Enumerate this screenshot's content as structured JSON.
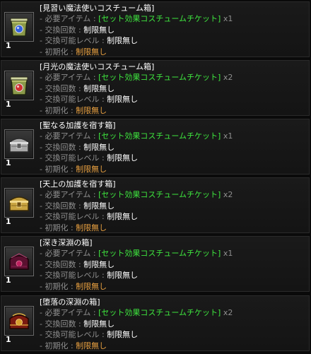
{
  "labels": {
    "required_item": "- 必要アイテム :",
    "exchange_count": "- 交換回数 :",
    "exchange_level": "- 交換可能レベル :",
    "reset": "- 初期化 :"
  },
  "items": [
    {
      "title": "[見習い魔法使いコスチューム箱]",
      "ticket": "[セット効果コスチュームチケット]",
      "ticket_qty": "x1",
      "count": "制限無し",
      "level": "制限無し",
      "reset": "制限無し",
      "quantity": "1",
      "icon": "green-costume-box-icon"
    },
    {
      "title": "[月光の魔法使いコスチューム箱]",
      "ticket": "[セット効果コスチュームチケット]",
      "ticket_qty": "x2",
      "count": "制限無し",
      "level": "制限無し",
      "reset": "制限無し",
      "quantity": "1",
      "icon": "green-costume-box-icon"
    },
    {
      "title": "[聖なる加護を宿す箱]",
      "ticket": "[セット効果コスチュームチケット]",
      "ticket_qty": "x1",
      "count": "制限無し",
      "level": "制限無し",
      "reset": "制限無し",
      "quantity": "1",
      "icon": "silver-chest-icon"
    },
    {
      "title": "[天上の加護を宿す箱]",
      "ticket": "[セット効果コスチュームチケット]",
      "ticket_qty": "x2",
      "count": "制限無し",
      "level": "制限無し",
      "reset": "制限無し",
      "quantity": "1",
      "icon": "gold-chest-icon"
    },
    {
      "title": "[深き深淵の箱]",
      "ticket": "[セット効果コスチュームチケット]",
      "ticket_qty": "x1",
      "count": "制限無し",
      "level": "制限無し",
      "reset": "制限無し",
      "quantity": "1",
      "icon": "dark-red-chest-icon"
    },
    {
      "title": "[堕落の深淵の箱]",
      "ticket": "[セット効果コスチュームチケット]",
      "ticket_qty": "x2",
      "count": "制限無し",
      "level": "制限無し",
      "reset": "制限無し",
      "quantity": "1",
      "icon": "red-gold-chest-icon"
    }
  ]
}
